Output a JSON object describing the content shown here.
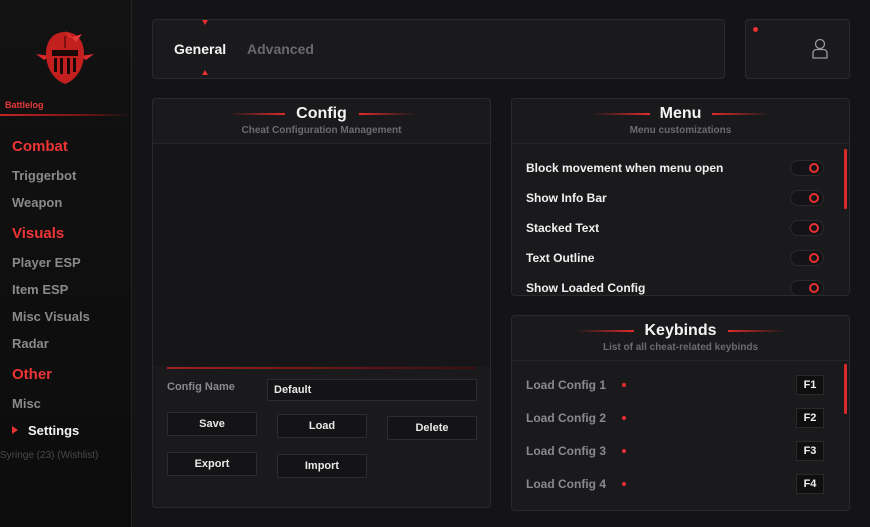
{
  "sidebar": {
    "brand": "Battlelog",
    "categories": [
      {
        "label": "Combat",
        "items": [
          "Triggerbot",
          "Weapon"
        ]
      },
      {
        "label": "Visuals",
        "items": [
          "Player ESP",
          "Item ESP",
          "Misc Visuals",
          "Radar"
        ]
      },
      {
        "label": "Other",
        "items": [
          "Misc",
          "Settings"
        ]
      }
    ],
    "active_item": "Settings",
    "ghost_text": "Syringe (23) (Wishlist)"
  },
  "tabs": [
    {
      "label": "General",
      "active": true
    },
    {
      "label": "Advanced",
      "active": false
    }
  ],
  "icons": {
    "logo": "knight-helmet-logo",
    "profile": "user-icon"
  },
  "config": {
    "title": "Config",
    "subtitle": "Cheat Configuration Management",
    "name_label": "Config Name",
    "name_value": "Default",
    "buttons": {
      "save": "Save",
      "load": "Load",
      "delete": "Delete",
      "export": "Export",
      "import": "Import"
    }
  },
  "menu": {
    "title": "Menu",
    "subtitle": "Menu customizations",
    "options": [
      {
        "label": "Block movement when menu open"
      },
      {
        "label": "Show Info Bar"
      },
      {
        "label": "Stacked Text"
      },
      {
        "label": "Text Outline"
      },
      {
        "label": "Show Loaded Config"
      }
    ]
  },
  "keybinds": {
    "title": "Keybinds",
    "subtitle": "List of all cheat-related keybinds",
    "binds": [
      {
        "label": "Load Config 1",
        "key": "F1"
      },
      {
        "label": "Load Config 2",
        "key": "F2"
      },
      {
        "label": "Load Config 3",
        "key": "F3"
      },
      {
        "label": "Load Config 4",
        "key": "F4"
      }
    ]
  },
  "colors": {
    "accent": "#e83030",
    "background": "#141416",
    "panel": "#1a1a1c",
    "muted_text": "#8a8a8c"
  }
}
